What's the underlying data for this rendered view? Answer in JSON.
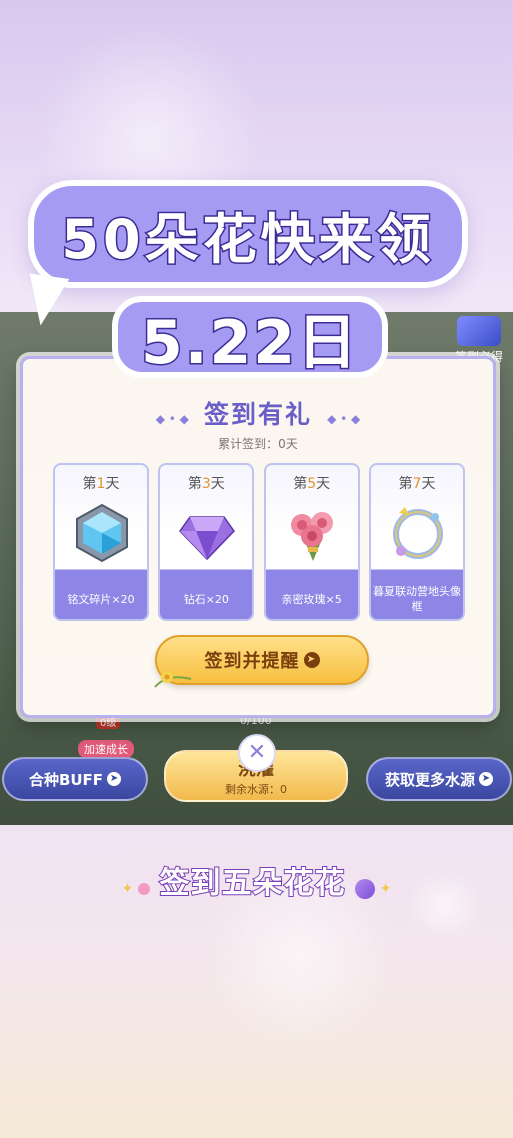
{
  "promo": {
    "headline": "50朵花快来领",
    "date": "5.22日",
    "caption": "签到五朵花花"
  },
  "scene": {
    "corner_label": "签到必得",
    "level_tag": "0级",
    "progress": "0/100",
    "speed_tag": "加速成长",
    "buttons": {
      "buff": "合种BUFF",
      "water": "浇灌",
      "water_sub": "剩余水源：0",
      "more_water": "获取更多水源"
    }
  },
  "dialog": {
    "title": "签到有礼",
    "cumulative": "累计签到：0天",
    "rewards": [
      {
        "day_prefix": "第",
        "day_num": "1",
        "day_suffix": "天",
        "item": "铭文碎片×20",
        "icon": "crystal-hexagon-icon"
      },
      {
        "day_prefix": "第",
        "day_num": "3",
        "day_suffix": "天",
        "item": "钻石×20",
        "icon": "diamond-icon"
      },
      {
        "day_prefix": "第",
        "day_num": "5",
        "day_suffix": "天",
        "item": "亲密玫瑰×5",
        "icon": "rose-bouquet-icon"
      },
      {
        "day_prefix": "第",
        "day_num": "7",
        "day_suffix": "天",
        "item": "暮夏联动营地头像框",
        "icon": "avatar-frame-icon"
      }
    ],
    "checkin_button": "签到并提醒",
    "close": "✕"
  },
  "colors": {
    "accent": "#6a5fc9",
    "card_band": "#8d86e6",
    "button_gold": "#f7bf3f",
    "day_number": "#e2942b"
  }
}
